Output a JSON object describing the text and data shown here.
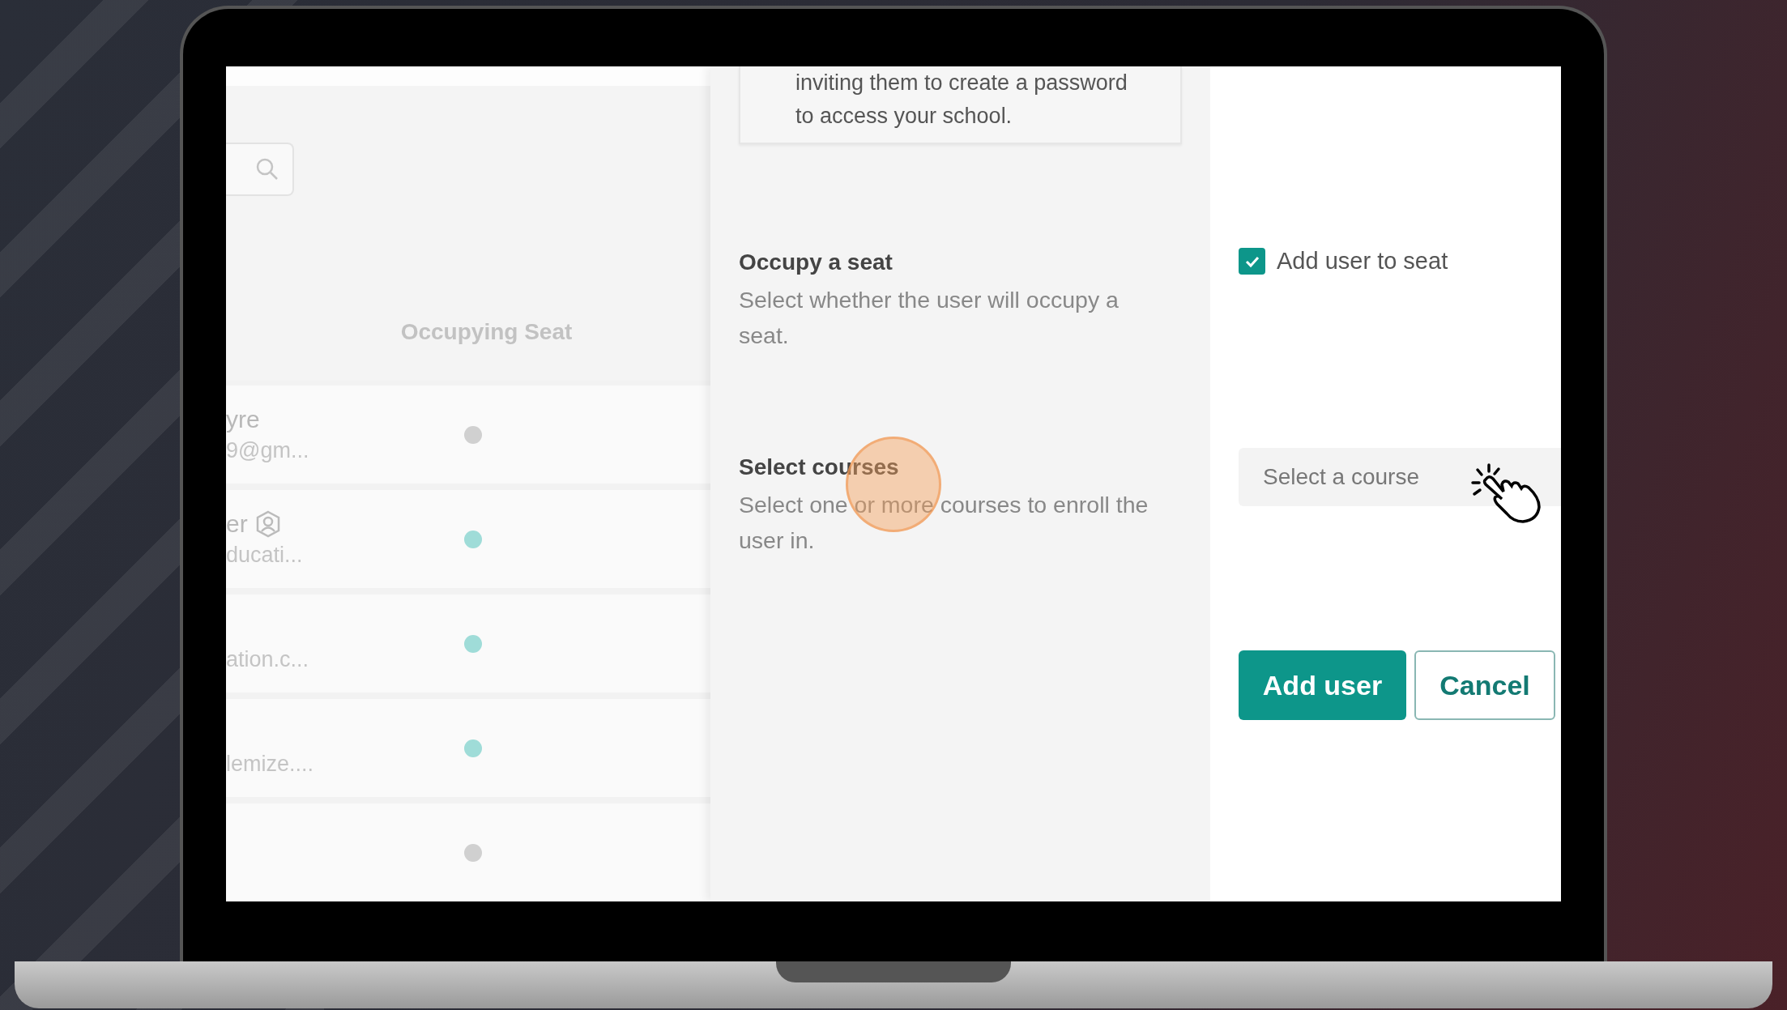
{
  "table": {
    "columns": [
      {
        "label": "Occupying Seat"
      }
    ],
    "rows": [
      {
        "name": "yre",
        "email": "9@gm...",
        "admin": false,
        "occupying": false
      },
      {
        "name": "er",
        "email": "ducati...",
        "admin": true,
        "occupying": true
      },
      {
        "name": "",
        "email": "ation.c...",
        "admin": false,
        "occupying": true
      },
      {
        "name": "",
        "email": "lemize....",
        "admin": false,
        "occupying": true
      },
      {
        "name": "",
        "email": "",
        "admin": false,
        "occupying": false
      }
    ]
  },
  "drawer": {
    "intro": "inviting them to create a password to access your school.",
    "sections": [
      {
        "kind": "checkbox",
        "title": "Occupy a seat",
        "description": "Select whether the user will occupy a seat.",
        "label": "Add user to seat",
        "checked": true
      },
      {
        "kind": "select",
        "title": "Select courses",
        "description": "Select one or more courses to enroll the user in.",
        "placeholder": "Select a course"
      }
    ],
    "buttons": [
      {
        "label": "Add user",
        "primary": true
      },
      {
        "label": "Cancel",
        "primary": false
      }
    ]
  }
}
